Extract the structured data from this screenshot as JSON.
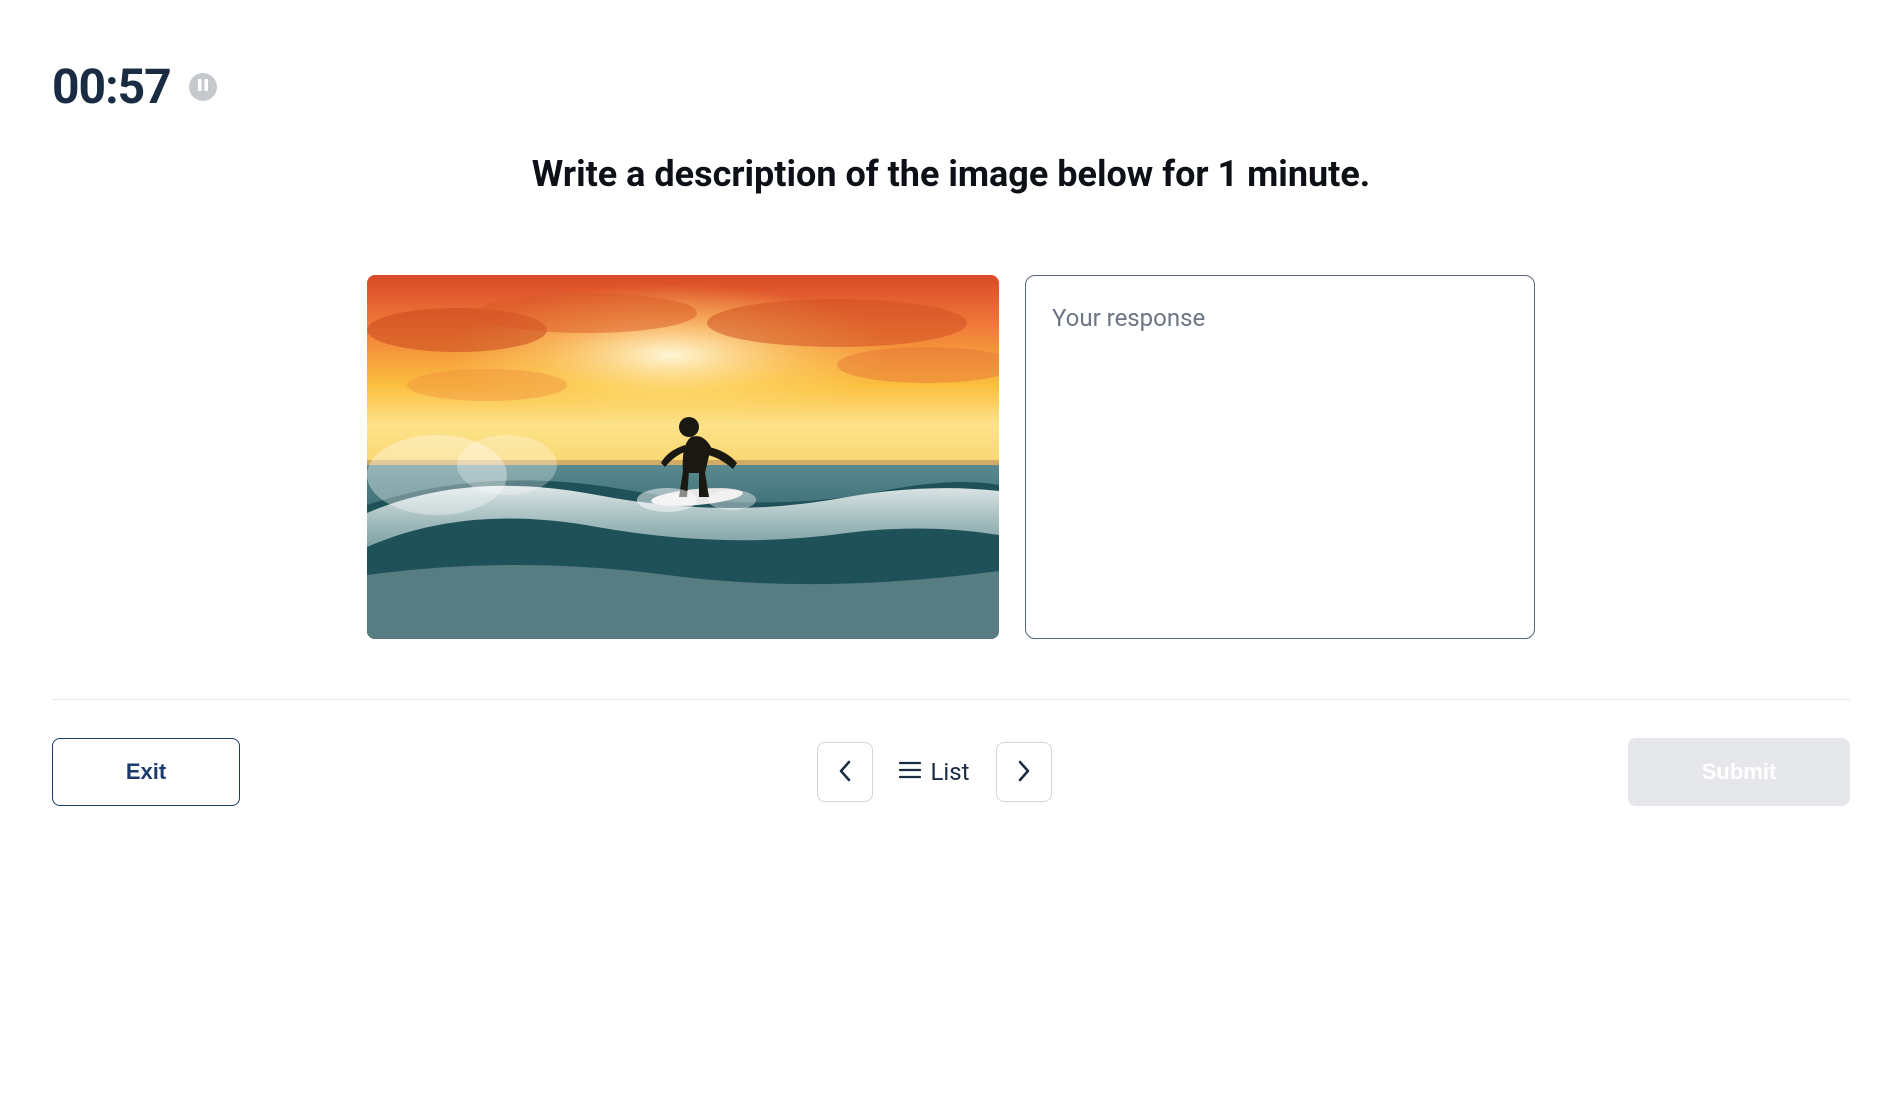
{
  "timer": {
    "value": "00:57"
  },
  "instruction": "Write a description of the image below for 1 minute.",
  "response": {
    "placeholder": "Your response",
    "value": ""
  },
  "footer": {
    "exit_label": "Exit",
    "list_label": "List",
    "submit_label": "Submit"
  }
}
